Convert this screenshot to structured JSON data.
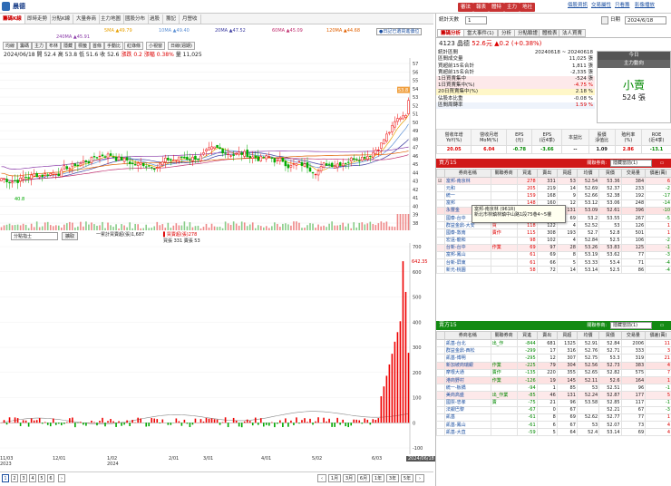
{
  "app": {
    "title": "晨德"
  },
  "top_buttons": [
    {
      "label": "審法",
      "color": "#c83232"
    },
    {
      "label": "報表",
      "color": "#c83232"
    },
    {
      "label": "體特",
      "color": "#c83232"
    },
    {
      "label": "主力",
      "color": "#c83232"
    },
    {
      "label": "地社",
      "color": "#c83232"
    }
  ],
  "top_links": [
    "個股資訊",
    "交易屬性",
    "只看籌",
    "影像播放"
  ],
  "tabs": [
    "籌碼K線",
    "即時走勢",
    "分點K線",
    "大量券商",
    "主力地圖",
    "國股分布",
    "過股",
    "籌記",
    "月營收"
  ],
  "ma_legend": [
    {
      "label": "5MA ▲49.79",
      "color": "#e8a000"
    },
    {
      "label": "10MA ▲49.40",
      "color": "#5b8fd4"
    },
    {
      "label": "20MA ▲47.52",
      "color": "#3c3ca0"
    },
    {
      "label": "60MA ▲45.09",
      "color": "#c03070"
    },
    {
      "label": "120MA ▲44.68",
      "color": "#e06000"
    },
    {
      "label": "240MA ▲45.91",
      "color": "#8a3aa8"
    }
  ],
  "legend_note": "●日記已選買進價位",
  "toolbar": [
    "均線",
    "籌碼",
    "主力",
    "布林",
    "隱藏",
    "標籤",
    "首條",
    "手動比",
    "紅綠條",
    "小視窗",
    "日線(週期)"
  ],
  "price_info": {
    "date": "2024/06/18",
    "open_label": "開",
    "open": "52.4",
    "high_label": "高",
    "high": "53.8",
    "low_label": "低",
    "low": "51.6",
    "close_label": "收",
    "close": "52.6",
    "change_label": "漲跌",
    "change": "0.2",
    "pct_label": "漲幅",
    "pct": "0.38%",
    "vol_label": "量",
    "vol": "11,025"
  },
  "price_axis": [
    "57",
    "56",
    "55",
    "54",
    "53",
    "52",
    "51",
    "50",
    "49",
    "48",
    "47",
    "46",
    "45",
    "44",
    "43",
    "42",
    "41",
    "40",
    "39",
    "38"
  ],
  "last_price_tag": "53.8",
  "chart_low_label": "40.8",
  "vol_legend": {
    "select": "分點指士",
    "button": "擴取",
    "line1": "一累計買賣超(張)1,687",
    "line2": "▌買賣超(張)278",
    "line3": "買張 331 賣張 53"
  },
  "vol_axis": [
    "700",
    "600",
    "500",
    "400",
    "300",
    "200",
    "100",
    "0",
    "-100"
  ],
  "vol_peak_tag": "642.35",
  "x_ticks": [
    "11/03\n2023",
    "12/01",
    "1/02\n2024",
    "2/01",
    "3/01",
    "4/01",
    "5/02",
    "6/03",
    "2024/06/18"
  ],
  "pager": {
    "pages": [
      "1",
      "2",
      "3",
      "4",
      "5",
      "6"
    ],
    "ranges": [
      "1月",
      "3月",
      "6月",
      "1年",
      "3年",
      "5年"
    ]
  },
  "right": {
    "stat_count_label": "統計天數",
    "stat_count": "1",
    "date_label": "日期",
    "date": "2024/6/18",
    "subtabs": [
      "籌碼分析",
      "當大事件(1)",
      "分析",
      "分點驗證",
      "體檢表",
      "法人買賣"
    ],
    "stock_line": "4123 晶德",
    "stock_price": "52.6元",
    "stock_change": "▲0.2 (+0.38%)",
    "stats": [
      {
        "k": "統計區間",
        "v": "20240618 ~ 20240618"
      },
      {
        "k": "區間成交量",
        "v": "11,025 張"
      },
      {
        "k": "買超前15名合計",
        "v": "1,811 張"
      },
      {
        "k": "賣超前15名合計",
        "v": "-2,335 張"
      },
      {
        "k": "1日買賣集中",
        "v": "-524 張"
      },
      {
        "k": "1日買賣集中(%)",
        "v": "-4.75 %"
      },
      {
        "k": "20日買賣集中(%)",
        "v": "2.18 %"
      },
      {
        "k": "佔股本比重",
        "v": "-0.08 %"
      },
      {
        "k": "區間周轉率",
        "v": "1.59 %"
      }
    ],
    "today_label": "今日",
    "today_sub": "主力動向",
    "today_action": "小賣",
    "today_amount": "524 張",
    "ratio_headers": [
      "營收年增\nYoY(%)",
      "營收月增\nMoM(%)",
      "EPS\n(元)",
      "EPS\n(近4季)",
      "本益比",
      "股價\n淨值比",
      "殖利率\n(%)",
      "ROE\n(近4季)"
    ],
    "ratio_values": [
      "20.05",
      "6.04",
      "-0.78",
      "-3.66",
      "--",
      "1.09",
      "2.86",
      "-13.1"
    ],
    "buy_header": "買方15",
    "sell_header": "賣方15",
    "select_label": "關聯券商:",
    "select_value": "隱藏當前(1)",
    "table_headers": [
      "",
      "券商名稱",
      "關聯券商",
      "買進",
      "賣出",
      "買超",
      "均價",
      "買價",
      "交易量",
      "價差(萬)"
    ],
    "buy_rows": [
      [
        "☑",
        "富邦-南京林",
        "",
        "278",
        "331",
        "53",
        "52.54",
        "53.36",
        "384",
        "6"
      ],
      [
        "",
        "元和",
        "",
        "205",
        "219",
        "14",
        "52.69",
        "52.37",
        "233",
        "-2"
      ],
      [
        "",
        "統一",
        "",
        "159",
        "168",
        "9",
        "52.66",
        "52.38",
        "192",
        "-17"
      ],
      [
        "",
        "富邦",
        "",
        "148",
        "160",
        "12",
        "53.12",
        "53.06",
        "248",
        "-14"
      ],
      [
        "",
        "永豐金",
        "",
        "130",
        "261",
        "131",
        "53.09",
        "52.61",
        "396",
        "-10"
      ],
      [
        "",
        "國泰-台中",
        "",
        "129",
        "198",
        "69",
        "53.2",
        "53.55",
        "267",
        "-5"
      ],
      [
        "",
        "群益金鼎-大安",
        "",
        "118",
        "122",
        "4",
        "52.52",
        "53",
        "126",
        "1"
      ],
      [
        "",
        "國泰-敦南",
        "",
        "115",
        "308",
        "193",
        "52.7",
        "52.8",
        "501",
        "1"
      ],
      [
        "",
        "宏遠-龍和",
        "",
        "98",
        "102",
        "4",
        "52.84",
        "52.5",
        "106",
        "-2"
      ],
      [
        "",
        "台新-台中",
        "",
        "69",
        "97",
        "28",
        "53.26",
        "53.83",
        "125",
        "-1"
      ],
      [
        "",
        "富邦-鳳山",
        "",
        "61",
        "69",
        "8",
        "53.19",
        "53.62",
        "77",
        "-3"
      ],
      [
        "",
        "台新-屏東",
        "",
        "61",
        "66",
        "5",
        "53.33",
        "53.4",
        "71",
        "-4"
      ],
      [
        "",
        "新光-桃園",
        "",
        "58",
        "72",
        "14",
        "53.14",
        "52.5",
        "86",
        "-4"
      ]
    ],
    "sell_rows": [
      [
        "",
        "凱基-台北",
        "",
        "-844",
        "681",
        "1325",
        "52.91",
        "52.84",
        "2006",
        "11"
      ],
      [
        "",
        "群益金鼎-西松",
        "",
        "-299",
        "17",
        "316",
        "52.76",
        "52.71",
        "333",
        "3"
      ],
      [
        "",
        "凱基-博明",
        "",
        "-295",
        "12",
        "307",
        "52.75",
        "53.3",
        "319",
        "21"
      ],
      [
        "",
        "新加坡商瑞銀",
        "",
        "-225",
        "79",
        "304",
        "52.56",
        "52.73",
        "383",
        "4"
      ],
      [
        "",
        "摩根大通",
        "",
        "-135",
        "220",
        "355",
        "52.65",
        "52.82",
        "575",
        "7"
      ],
      [
        "",
        "港商野村",
        "",
        "-126",
        "19",
        "145",
        "52.11",
        "52.6",
        "164",
        "1"
      ],
      [
        "",
        "統一-板橋",
        "",
        "-94",
        "1",
        "85",
        "53",
        "52.51",
        "96",
        "-1"
      ],
      [
        "",
        "美商高盛",
        "",
        "-85",
        "46",
        "131",
        "52.24",
        "52.87",
        "177",
        "5"
      ],
      [
        "",
        "國票-忠孝",
        "",
        "-75",
        "21",
        "96",
        "53.58",
        "52.85",
        "117",
        "-1"
      ],
      [
        "",
        "法銀巴黎",
        "",
        "-67",
        "0",
        "67",
        "",
        "52.21",
        "67",
        "-3"
      ],
      [
        "",
        "凱基",
        "",
        "-61",
        "8",
        "69",
        "52.62",
        "52.77",
        "77",
        "1"
      ],
      [
        "",
        "凱基-鳳山",
        "",
        "-61",
        "6",
        "67",
        "53",
        "52.07",
        "73",
        "4"
      ],
      [
        "",
        "凱基-大直",
        "",
        "-59",
        "5",
        "64",
        "52.4",
        "53.14",
        "69",
        "4"
      ]
    ],
    "buy_tags": {
      "4": "",
      "6": "買",
      "7": "賣作",
      "9": "作業"
    },
    "sell_tags": {
      "0": "出_作",
      "3": "作業",
      "4": "賣作",
      "5": "作業",
      "7": "出_作業",
      "8": "賣"
    },
    "tooltip_line1": "富邦-南京林 (961R)",
    "tooltip_line2": "新北市林鎮林鎮中山路1段75巷4~5樓"
  },
  "chart_data": {
    "type": "candlestick",
    "last_close": 52.6,
    "y_range": [
      38,
      57
    ],
    "x_range": [
      "2023/11/03",
      "2024/06/18"
    ]
  }
}
